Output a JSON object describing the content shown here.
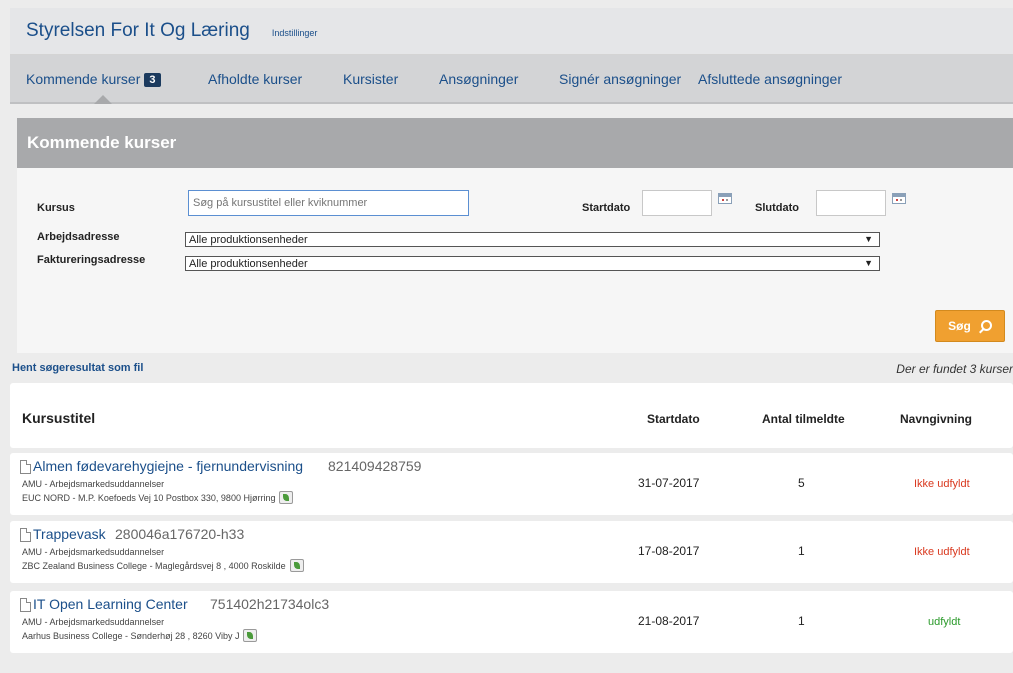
{
  "header": {
    "title": "Styrelsen For It Og Læring",
    "settings_label": "Indstillinger"
  },
  "nav": {
    "items": [
      {
        "label": "Kommende kurser",
        "badge": "3"
      },
      {
        "label": "Afholdte kurser"
      },
      {
        "label": "Kursister"
      },
      {
        "label": "Ansøgninger"
      },
      {
        "label": "Signér ansøgninger"
      },
      {
        "label": "Afsluttede ansøgninger"
      }
    ]
  },
  "section": {
    "title": "Kommende kurser"
  },
  "filters": {
    "kursus_label": "Kursus",
    "kursus_placeholder": "Søg på kursustitel eller kviknummer",
    "startdato_label": "Startdato",
    "slutdato_label": "Slutdato",
    "arbejdsadresse_label": "Arbejdsadresse",
    "arbejdsadresse_value": "Alle produktionsenheder",
    "faktureringsadresse_label": "Faktureringsadresse",
    "faktureringsadresse_value": "Alle produktionsenheder",
    "search_label": "Søg"
  },
  "results": {
    "download_label": "Hent søgeresultat som fil",
    "count_text": "Der er fundet 3 kurser"
  },
  "table": {
    "headers": {
      "title": "Kursustitel",
      "startdato": "Startdato",
      "antal": "Antal tilmeldte",
      "navngivning": "Navngivning"
    },
    "rows": [
      {
        "title": "Almen fødevarehygiejne - fjernundervisning",
        "code": "821409428759",
        "category": "Arbejdsmarkedsuddannelser",
        "category_prefix": "AMU",
        "location": "EUC NORD - M.P. Koefoeds Vej 10 Postbox 330, 9800 Hjørring",
        "startdato": "31-07-2017",
        "antal": "5",
        "status": "Ikke udfyldt"
      },
      {
        "title": "Trappevask",
        "code": "280046a176720-h33",
        "category": "Arbejdsmarkedsuddannelser",
        "category_prefix": "AMU",
        "location": "ZBC Zealand Business College - Maglegårdsvej 8 , 4000 Roskilde",
        "startdato": "17-08-2017",
        "antal": "1",
        "status": "Ikke udfyldt"
      },
      {
        "title": "IT Open Learning Center",
        "code": "751402h21734olc3",
        "category": "Arbejdsmarkedsuddannelser",
        "category_prefix": "AMU",
        "location": "Aarhus Business College - Sønderhøj 28 , 8260 Viby J",
        "startdato": "21-08-2017",
        "antal": "1",
        "status": "udfyldt"
      }
    ]
  },
  "colors": {
    "link": "#1b4f8a",
    "status_bad": "#d9381e",
    "status_ok": "#2a9a2a",
    "accent_button": "#f0a030"
  }
}
